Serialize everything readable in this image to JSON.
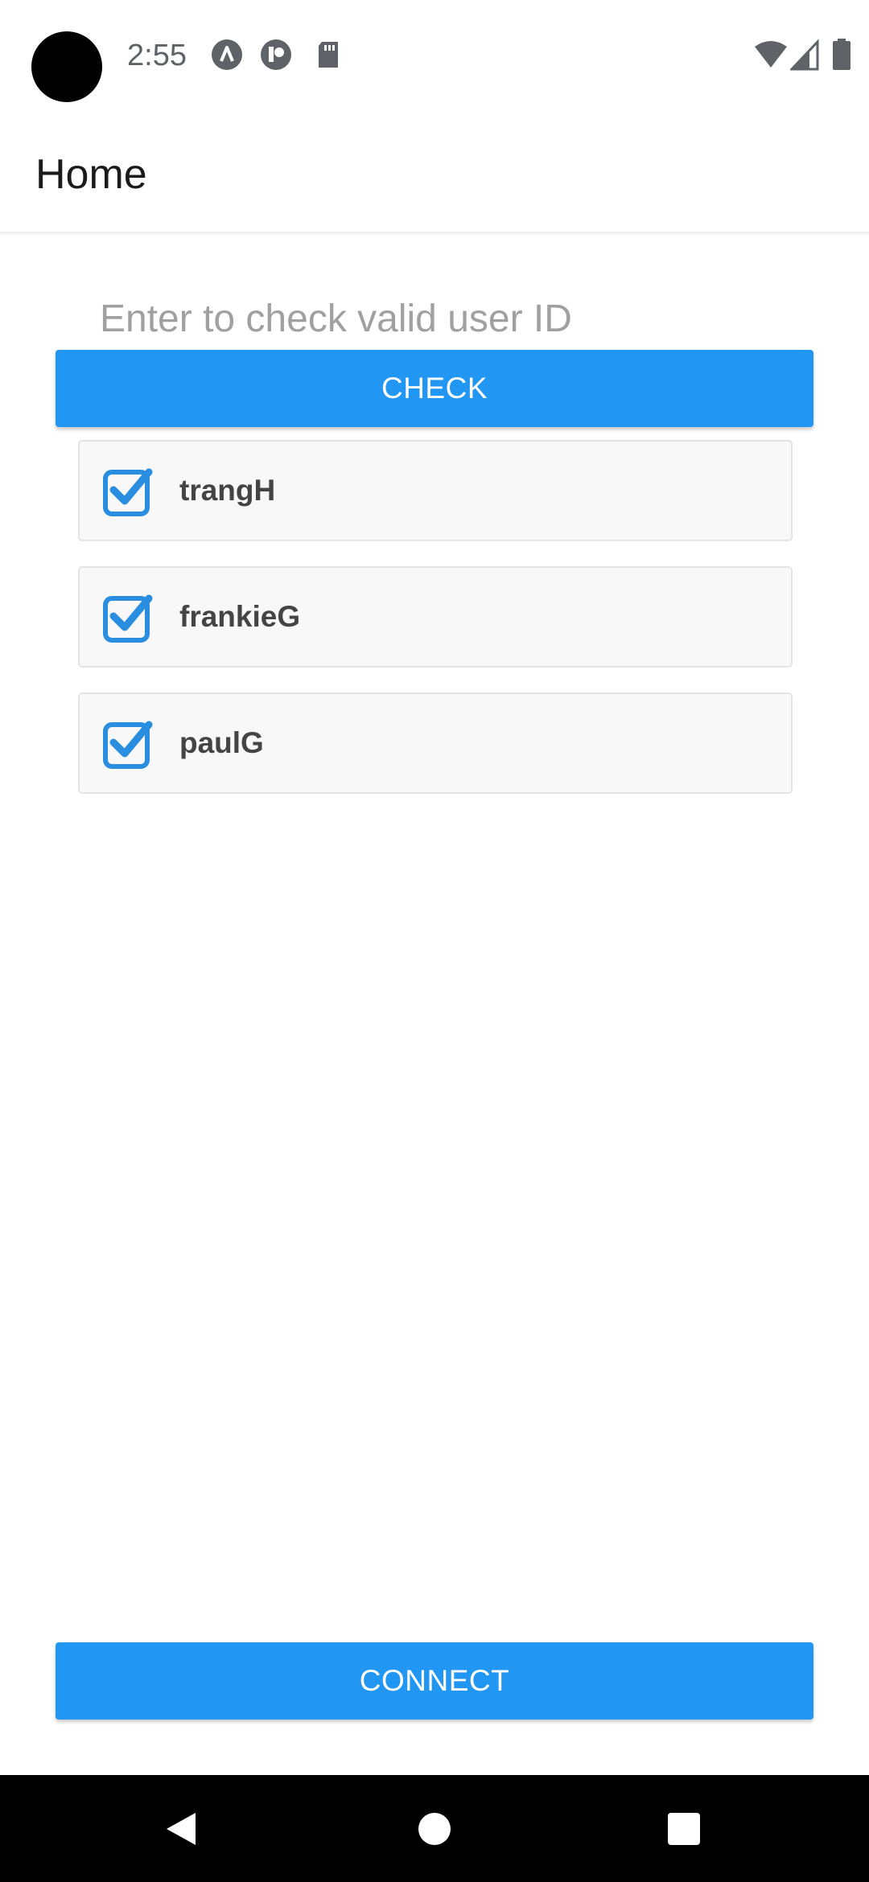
{
  "status_bar": {
    "time": "2:55",
    "notification_icons": [
      "app-a-icon",
      "app-p-icon",
      "sd-card-icon"
    ],
    "right_icons": [
      "wifi-icon",
      "cell-signal-icon",
      "battery-icon"
    ]
  },
  "app_bar": {
    "title": "Home"
  },
  "userid_input": {
    "value": "",
    "placeholder": "Enter to check valid user ID"
  },
  "check_button": {
    "label": "CHECK"
  },
  "users": [
    {
      "name": "trangH",
      "checked": true
    },
    {
      "name": "frankieG",
      "checked": true
    },
    {
      "name": "paulG",
      "checked": true
    }
  ],
  "connect_button": {
    "label": "CONNECT"
  },
  "nav_bar": {
    "buttons": [
      "back-icon",
      "home-icon",
      "recents-icon"
    ]
  },
  "colors": {
    "accent": "#2196f3",
    "checkbox": "#2a8ee0",
    "item_background": "#f8f8f8",
    "nav_background": "#000000"
  }
}
